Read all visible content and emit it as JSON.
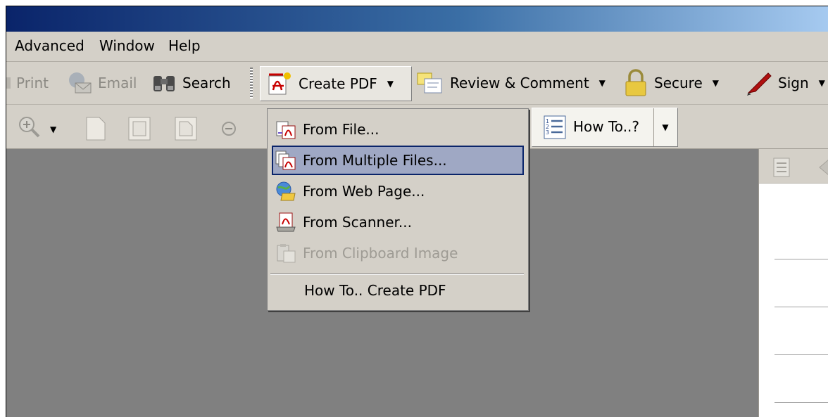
{
  "menu": {
    "items": [
      "Advanced",
      "Window",
      "Help"
    ]
  },
  "toolbar": {
    "print": "Print",
    "email": "Email",
    "search": "Search",
    "create_pdf": "Create PDF",
    "review_comment": "Review & Comment",
    "secure": "Secure",
    "sign": "Sign"
  },
  "howto": {
    "label": "How To..?"
  },
  "create_pdf_menu": {
    "items": [
      {
        "label": "From File...",
        "state": "normal",
        "icon": "file-convert-icon"
      },
      {
        "label": "From Multiple Files...",
        "state": "selected",
        "icon": "multiple-files-icon"
      },
      {
        "label": "From Web Page...",
        "state": "normal",
        "icon": "web-page-icon"
      },
      {
        "label": "From Scanner...",
        "state": "normal",
        "icon": "scanner-icon"
      },
      {
        "label": "From Clipboard Image",
        "state": "disabled",
        "icon": "clipboard-icon"
      }
    ],
    "howto": "How To.. Create PDF"
  },
  "colors": {
    "selection": "#9fa8c4",
    "selection_border": "#0a246a",
    "workspace": "#808080",
    "chrome": "#d4d0c8"
  }
}
